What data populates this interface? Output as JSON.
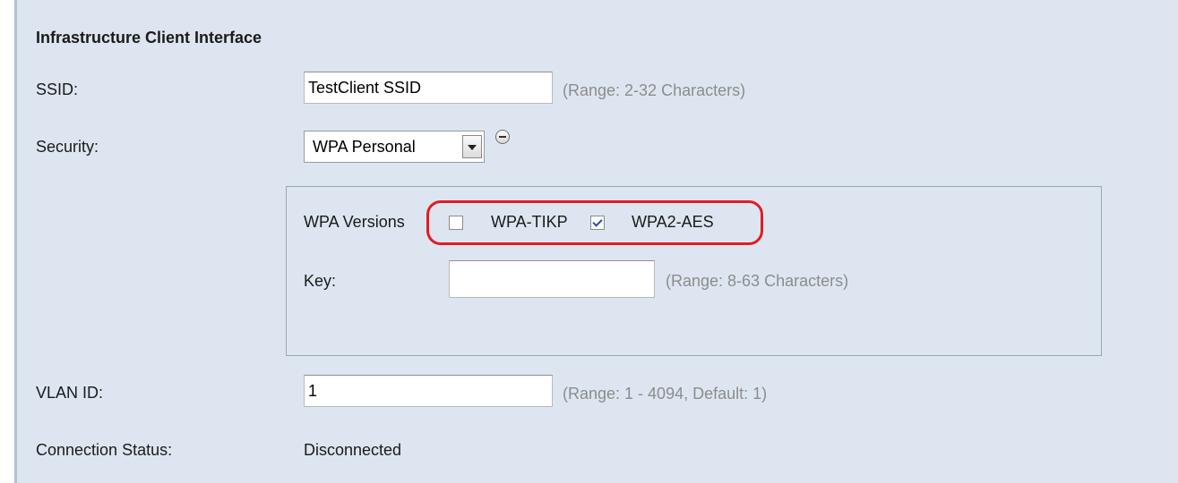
{
  "section": {
    "title": "Infrastructure Client Interface"
  },
  "ssid": {
    "label": "SSID:",
    "value": "TestClient SSID",
    "hint": "(Range: 2-32 Characters)"
  },
  "security": {
    "label": "Security:",
    "selected": "WPA Personal",
    "collapse_icon": "minus-circle-icon",
    "wpa_versions": {
      "label": "WPA Versions",
      "options": [
        {
          "label": "WPA-TIKP",
          "checked": false
        },
        {
          "label": "WPA2-AES",
          "checked": true
        }
      ]
    },
    "key": {
      "label": "Key:",
      "value": "",
      "hint": "(Range: 8-63 Characters)"
    }
  },
  "vlan": {
    "label": "VLAN ID:",
    "value": "1",
    "hint": "(Range: 1 - 4094, Default: 1)"
  },
  "connection": {
    "label": "Connection Status:",
    "value": "Disconnected"
  },
  "colors": {
    "panel_bg": "#dde6f0",
    "highlight": "#e31b23",
    "hint_text": "#8c8c8c"
  }
}
